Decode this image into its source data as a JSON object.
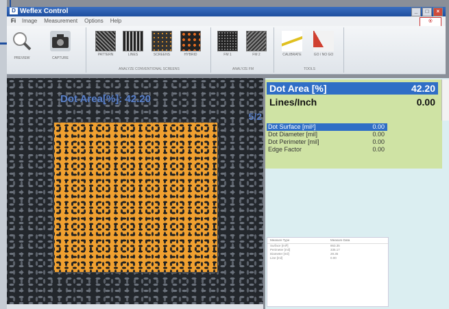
{
  "app": {
    "title": "Weflex Control",
    "brand": "®"
  },
  "menu": {
    "file": "Fi",
    "items": [
      "Image",
      "Measurement",
      "Options",
      "Help"
    ]
  },
  "ribbon": {
    "preview_label": "PREVIEW",
    "capture_label": "CAPTURE",
    "screens_group": "ANALYZE CONVENTIONAL SCREENS",
    "screens_items": [
      "PATTERN",
      "LINES",
      "SCREENS",
      "HYBRID"
    ],
    "fm_group": "ANALYZE FM",
    "fm_items": [
      "FM 1",
      "FM 2"
    ],
    "tools_group": "TOOLS",
    "tools_items": [
      "CALIBRATE",
      "GO / NO GO"
    ]
  },
  "image_panel": {
    "overlay": "Dot Area[%]:  42.20",
    "page_indicator": "5/2"
  },
  "results": {
    "dot_area_label": "Dot Area [%]",
    "dot_area_value": "42.20",
    "lines_label": "Lines/Inch",
    "lines_value": "0.00",
    "measurements": [
      {
        "label": "Dot Surface [mil²]",
        "value": "0.00"
      },
      {
        "label": "Dot Diameter [mil]",
        "value": "0.00"
      },
      {
        "label": "Dot Perimeter [mil]",
        "value": "0.00"
      },
      {
        "label": "Edge Factor",
        "value": "0.00"
      }
    ]
  },
  "table": {
    "headers": [
      "Measure Type",
      "Measure Data"
    ],
    "rows": [
      [
        "Surface [mil²]",
        "863.35"
      ],
      [
        "Perimeter [mil]",
        "335.17"
      ],
      [
        "Diameter [mil]",
        "28.35"
      ],
      [
        "Line [mil]",
        "0.00"
      ]
    ]
  },
  "colors": {
    "accent": "#2f6ec6",
    "roi_fill": "#f0a030",
    "panel_green": "#cfe3a4"
  }
}
